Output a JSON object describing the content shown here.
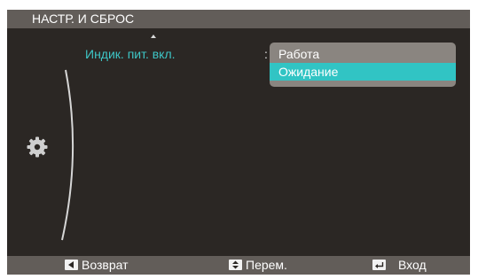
{
  "menu": {
    "title": "НАСТР. И СБРОС"
  },
  "setting": {
    "label": "Индик. пит. вкл.",
    "separator": ":",
    "options": [
      {
        "label": "Работа",
        "selected": false
      },
      {
        "label": "Ожидание",
        "selected": true
      }
    ]
  },
  "sidebar": {
    "icon": "gear-icon"
  },
  "footer": {
    "back_label": "Возврат",
    "move_label": "Перем.",
    "enter_label": "Вход"
  },
  "colors": {
    "osd_background": "#2b2724",
    "bar_background": "#625d59",
    "accent": "#31c4c4",
    "dropdown": "#8a8580"
  }
}
